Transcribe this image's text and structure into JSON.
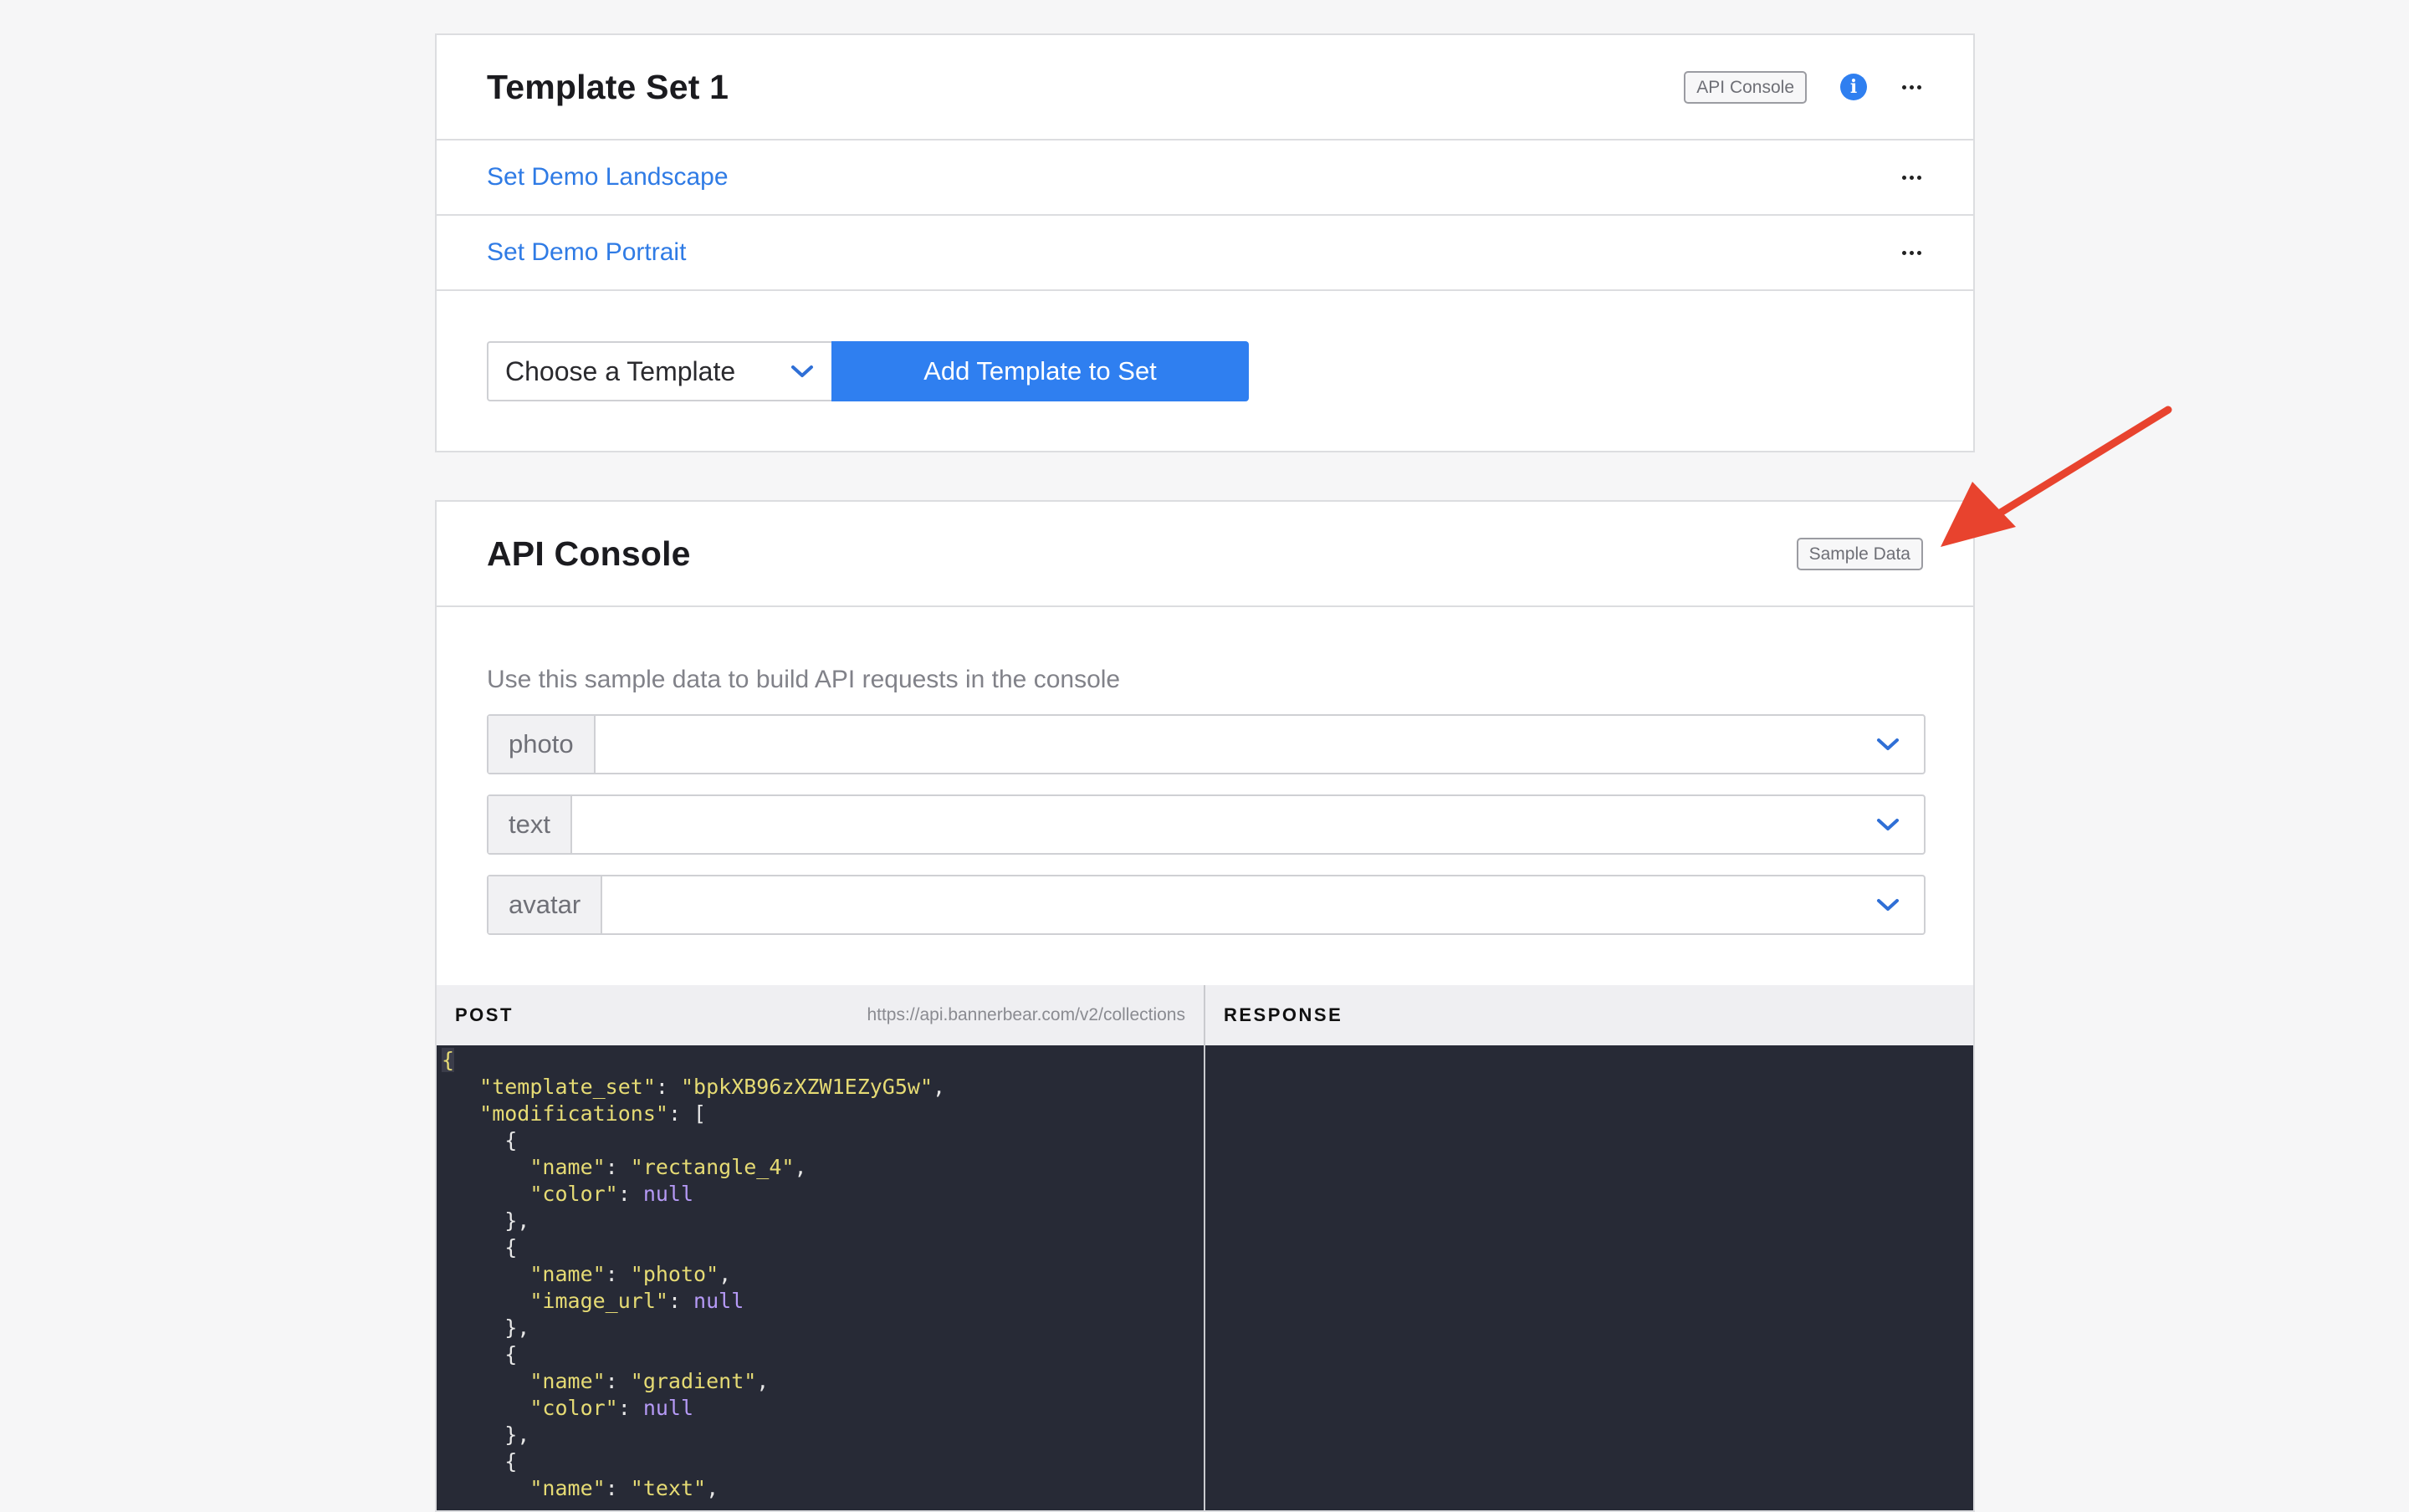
{
  "template_set_card": {
    "title": "Template Set 1",
    "api_console_badge": "API Console",
    "items": [
      {
        "label": "Set Demo Landscape"
      },
      {
        "label": "Set Demo Portrait"
      }
    ],
    "template_select": {
      "value": "Choose a Template"
    },
    "add_button_label": "Add Template to Set"
  },
  "api_console_card": {
    "title": "API Console",
    "sample_data_badge": "Sample Data",
    "intro": "Use this sample data to build API requests in the console",
    "fields": [
      {
        "label": "photo",
        "value": ""
      },
      {
        "label": "text",
        "value": ""
      },
      {
        "label": "avatar",
        "value": ""
      }
    ],
    "post_pane": {
      "method": "POST",
      "url": "https://api.bannerbear.com/v2/collections"
    },
    "response_pane": {
      "label": "RESPONSE"
    },
    "request_body": {
      "template_set_key": "\"template_set\"",
      "template_set_value": "\"bpkXB96zXZW1EZyG5w\"",
      "modifications_key": "\"modifications\"",
      "name_key": "\"name\"",
      "color_key": "\"color\"",
      "image_url_key": "\"image_url\"",
      "null": "null",
      "mod_names": [
        "\"rectangle_4\"",
        "\"photo\"",
        "\"gradient\"",
        "\"text\""
      ]
    }
  },
  "colors": {
    "accent": "#2f7ff0",
    "link": "#2f7be5",
    "code_bg": "#272a36",
    "arrow": "#e8432e"
  }
}
